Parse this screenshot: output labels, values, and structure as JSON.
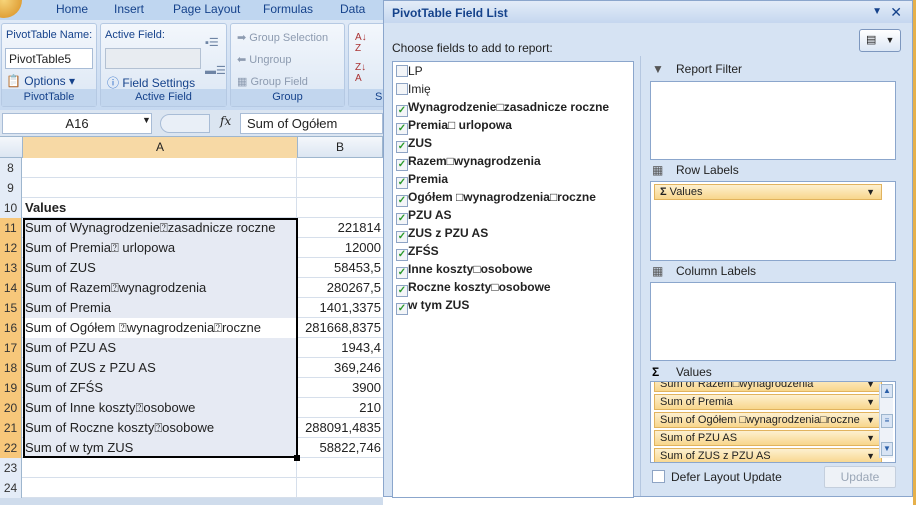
{
  "ribbon_tabs": [
    "Home",
    "Insert",
    "Page Layout",
    "Formulas",
    "Data"
  ],
  "ribbon": {
    "pivottable": {
      "name_label": "PivotTable Name:",
      "name_value": "PivotTable5",
      "options": "Options",
      "caption": "PivotTable"
    },
    "active_field": {
      "label": "Active Field:",
      "value": "",
      "field_settings": "Field Settings",
      "caption": "Active Field"
    },
    "group": {
      "group_selection": "Group Selection",
      "ungroup": "Ungroup",
      "group_field": "Group Field",
      "caption": "Group"
    },
    "sort": {
      "caption": "S"
    }
  },
  "formula_bar": {
    "name_box": "A16",
    "fx": "fx",
    "formula": "Sum of Ogółem"
  },
  "columns": [
    "A",
    "B"
  ],
  "rows": [
    {
      "n": "8",
      "a": "",
      "b": ""
    },
    {
      "n": "9",
      "a": "",
      "b": ""
    },
    {
      "n": "10",
      "a": "Values",
      "b": ""
    },
    {
      "n": "11",
      "a": "Sum of Wynagrodzenie⍰zasadnicze roczne",
      "b": "221814"
    },
    {
      "n": "12",
      "a": "Sum of Premia⍰ urlopowa",
      "b": "12000"
    },
    {
      "n": "13",
      "a": "Sum of ZUS",
      "b": "58453,5"
    },
    {
      "n": "14",
      "a": "Sum of Razem⍰wynagrodzenia",
      "b": "280267,5"
    },
    {
      "n": "15",
      "a": "Sum of Premia",
      "b": "1401,3375"
    },
    {
      "n": "16",
      "a": "Sum of Ogółem ⍰wynagrodzenia⍰roczne",
      "b": "281668,8375"
    },
    {
      "n": "17",
      "a": "Sum of PZU AS",
      "b": "1943,4"
    },
    {
      "n": "18",
      "a": "Sum of ZUS z PZU AS",
      "b": "369,246"
    },
    {
      "n": "19",
      "a": "Sum of ZFŚS",
      "b": "3900"
    },
    {
      "n": "20",
      "a": "Sum of Inne koszty⍰osobowe",
      "b": "210"
    },
    {
      "n": "21",
      "a": "Sum of Roczne koszty⍰osobowe",
      "b": "288091,4835"
    },
    {
      "n": "22",
      "a": "Sum of w tym ZUS",
      "b": "58822,746"
    },
    {
      "n": "23",
      "a": "",
      "b": ""
    },
    {
      "n": "24",
      "a": "",
      "b": ""
    }
  ],
  "panel": {
    "title": "PivotTable Field List",
    "choose_label": "Choose fields to add to report:",
    "fields": [
      {
        "label": "LP",
        "checked": false
      },
      {
        "label": "Imię",
        "checked": false
      },
      {
        "label": "Wynagrodzenie□zasadnicze roczne",
        "checked": true
      },
      {
        "label": "Premia□ urlopowa",
        "checked": true
      },
      {
        "label": "ZUS",
        "checked": true
      },
      {
        "label": "Razem□wynagrodzenia",
        "checked": true
      },
      {
        "label": "Premia",
        "checked": true
      },
      {
        "label": "Ogółem □wynagrodzenia□roczne",
        "checked": true
      },
      {
        "label": "PZU AS",
        "checked": true
      },
      {
        "label": "ZUS z PZU AS",
        "checked": true
      },
      {
        "label": "ZFŚS",
        "checked": true
      },
      {
        "label": "Inne koszty□osobowe",
        "checked": true
      },
      {
        "label": "Roczne koszty□osobowe",
        "checked": true
      },
      {
        "label": "w tym ZUS",
        "checked": true
      }
    ],
    "report_filter": "Report Filter",
    "row_labels": "Row Labels",
    "row_items": [
      "Values"
    ],
    "column_labels": "Column Labels",
    "values_label": "Values",
    "value_items": [
      "Sum of Razem□wynagrodzenia",
      "Sum of Premia",
      "Sum of Ogółem □wynagrodzenia□roczne",
      "Sum of PZU AS",
      "Sum of ZUS z PZU AS"
    ],
    "defer_label": "Defer Layout Update",
    "defer_checked": false,
    "update_button": "Update"
  }
}
